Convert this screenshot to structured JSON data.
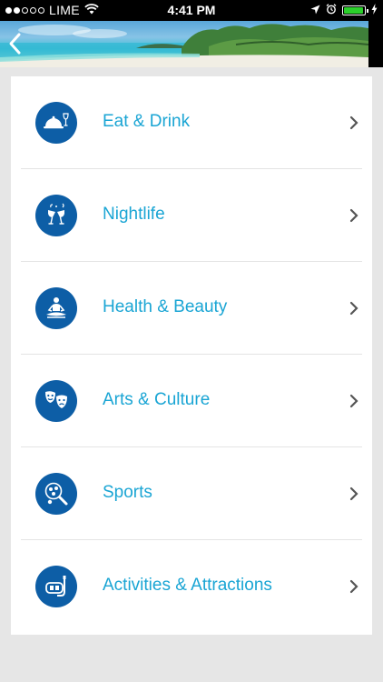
{
  "status_bar": {
    "carrier": "LIME",
    "time": "4:41 PM",
    "signal_bars": 2,
    "battery_level": 0.95
  },
  "header": {
    "back_icon": "chevron-left-icon"
  },
  "menu": {
    "items": [
      {
        "label": "Eat & Drink",
        "icon": "dining-icon"
      },
      {
        "label": "Nightlife",
        "icon": "cocktails-icon"
      },
      {
        "label": "Health & Beauty",
        "icon": "meditation-icon"
      },
      {
        "label": "Arts & Culture",
        "icon": "theater-masks-icon"
      },
      {
        "label": "Sports",
        "icon": "sports-balls-icon"
      },
      {
        "label": "Activities & Attractions",
        "icon": "snorkel-mask-icon"
      }
    ]
  },
  "colors": {
    "accent": "#1aa5d4",
    "icon_bg": "#0d5ea6",
    "background": "#e6e6e6"
  }
}
